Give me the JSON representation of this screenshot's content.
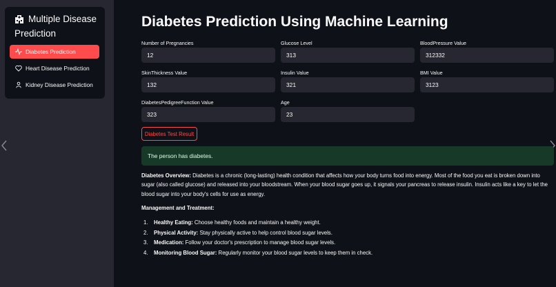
{
  "sidebar": {
    "title": "Multiple Disease Prediction",
    "menu": [
      {
        "label": "Diabetes Prediction",
        "icon": "activity-icon",
        "active": true
      },
      {
        "label": "Heart Disease Prediction",
        "icon": "heart-icon",
        "active": false
      },
      {
        "label": "Kidney Disease Prediction",
        "icon": "person-icon",
        "active": false
      }
    ]
  },
  "colors": {
    "accent": "#ff4b4b",
    "background": "#0e1117",
    "sidebar": "#262730",
    "input": "#262730",
    "success_bg": "#173928"
  },
  "main": {
    "title": "Diabetes Prediction Using Machine Learning",
    "fields": [
      {
        "label": "Number of Pregnancies",
        "value": "12"
      },
      {
        "label": "Glucose Level",
        "value": "313"
      },
      {
        "label": "BloodPressure Value",
        "value": "312332"
      },
      {
        "label": "SkinThickness Value",
        "value": "132"
      },
      {
        "label": "Insulin Value",
        "value": "321"
      },
      {
        "label": "BMI Value",
        "value": "3123"
      },
      {
        "label": "DiabetesPedigreeFunction Value",
        "value": "323"
      },
      {
        "label": "Age",
        "value": "23"
      }
    ],
    "button_label": "Diabetes Test Result",
    "result": "The person has diabetes.",
    "overview_title": "Diabetes Overview:",
    "overview_text": " Diabetes is a chronic (long-lasting) health condition that affects how your body turns food into energy. Most of the food you eat is broken down into sugar (also called glucose) and released into your bloodstream. When your blood sugar goes up, it signals your pancreas to release insulin. Insulin acts like a key to let the blood sugar into your body's cells for use as energy.",
    "management_title": "Management and Treatment:",
    "management": [
      {
        "num": "1.",
        "title": "Healthy Eating:",
        "text": " Choose healthy foods and maintain a healthy weight."
      },
      {
        "num": "2.",
        "title": "Physical Activity:",
        "text": " Stay physically active to help control blood sugar levels."
      },
      {
        "num": "3.",
        "title": "Medication:",
        "text": " Follow your doctor's prescription to manage blood sugar levels."
      },
      {
        "num": "4.",
        "title": "Monitoring Blood Sugar:",
        "text": " Regularly monitor your blood sugar levels to keep them in check."
      }
    ]
  }
}
